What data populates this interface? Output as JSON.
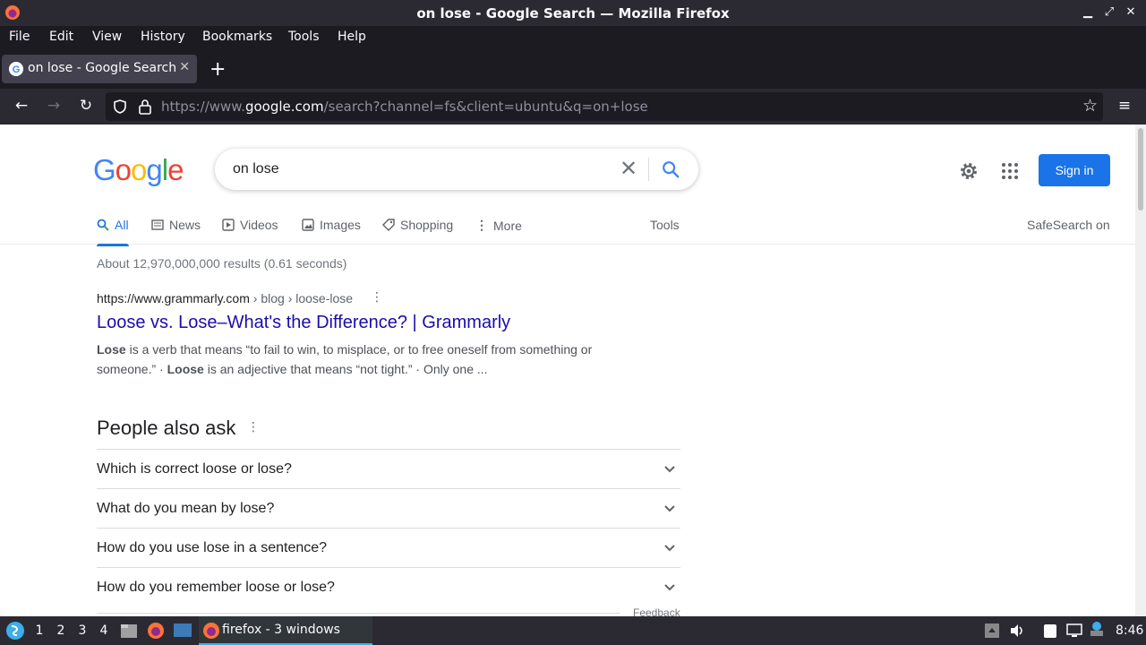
{
  "window": {
    "title": "on lose - Google Search — Mozilla Firefox"
  },
  "menu": [
    "File",
    "Edit",
    "View",
    "History",
    "Bookmarks",
    "Tools",
    "Help"
  ],
  "tab": {
    "label": "on lose - Google Search"
  },
  "address": {
    "prefix": "https://www.",
    "domain": "google.com",
    "rest": "/search?channel=fs&client=ubuntu&q=on+lose"
  },
  "google": {
    "query": "on lose",
    "signin": "Sign in",
    "tabs": [
      "All",
      "News",
      "Videos",
      "Images",
      "Shopping",
      "More"
    ],
    "tools": "Tools",
    "safesearch": "SafeSearch on",
    "results_count": "About 12,970,000,000 results (0.61 seconds)",
    "result": {
      "site": "https://www.grammarly.com",
      "path": " › blog › loose-lose",
      "title": "Loose vs. Lose–What's the Difference? | Grammarly",
      "snippet_b1": "Lose",
      "snippet_t1": " is a verb that means “to fail to win, to misplace, or to free oneself from something or someone.” · ",
      "snippet_b2": "Loose",
      "snippet_t2": " is an adjective that means “not tight.” · Only one ..."
    },
    "paa": {
      "title": "People also ask",
      "questions": [
        "Which is correct loose or lose?",
        "What do you mean by lose?",
        "How do you use lose in a sentence?",
        "How do you remember loose or lose?"
      ]
    },
    "feedback": "Feedback"
  },
  "taskbar": {
    "workspaces": [
      "1",
      "2",
      "3",
      "4"
    ],
    "task": "firefox - 3 windows",
    "clock": "8:46"
  },
  "colors": {
    "google_blue": "#1a73e8",
    "link": "#1a0dab",
    "firefox_dark": "#2b2a33"
  }
}
